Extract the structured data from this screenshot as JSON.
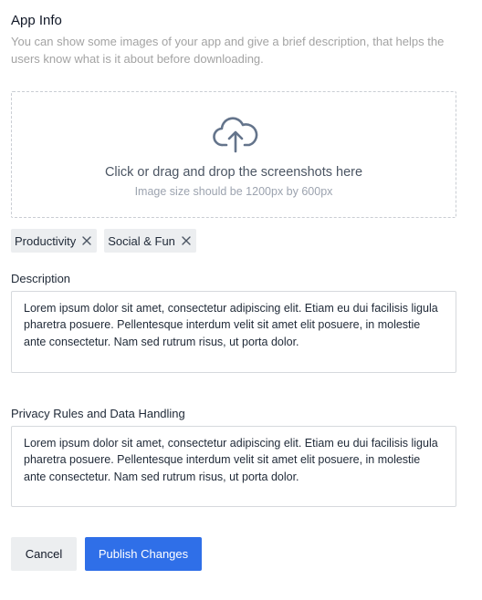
{
  "section": {
    "title": "App Info",
    "subtitle": "You can show some images of your app and give a brief description, that helps the users know what is it about before downloading."
  },
  "upload": {
    "icon": "cloud-upload-icon",
    "title": "Click or drag and drop the screenshots here",
    "hint": "Image size should be 1200px by 600px"
  },
  "tags": [
    {
      "label": "Productivity",
      "remove_icon": "close-icon"
    },
    {
      "label": "Social & Fun",
      "remove_icon": "close-icon"
    }
  ],
  "description": {
    "label": "Description",
    "value": "Lorem ipsum dolor sit amet, consectetur adipiscing elit. Etiam eu dui facilisis ligula pharetra posuere. Pellentesque interdum velit sit amet elit posuere, in molestie ante consectetur. Nam sed rutrum risus, ut porta dolor."
  },
  "privacy": {
    "label": "Privacy Rules and Data Handling",
    "value": "Lorem ipsum dolor sit amet, consectetur adipiscing elit. Etiam eu dui facilisis ligula pharetra posuere. Pellentesque interdum velit sit amet elit posuere, in molestie ante consectetur. Nam sed rutrum risus, ut porta dolor."
  },
  "actions": {
    "cancel_label": "Cancel",
    "publish_label": "Publish Changes"
  },
  "colors": {
    "primary": "#2f6fe8",
    "secondary_button": "#eceef0",
    "muted_text": "#a3a3a3"
  }
}
